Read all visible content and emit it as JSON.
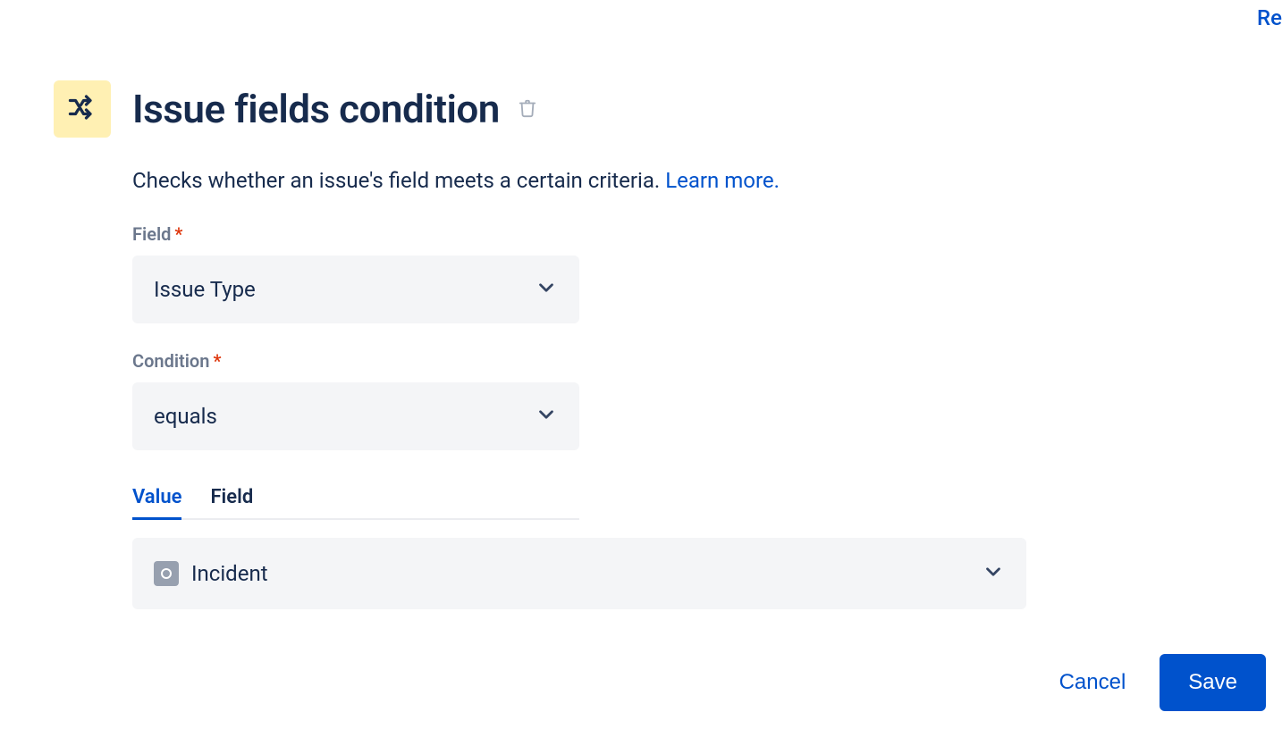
{
  "topLink": "Re",
  "header": {
    "title": "Issue fields condition"
  },
  "description": "Checks whether an issue's field meets a certain criteria. ",
  "learnMore": "Learn more.",
  "fields": {
    "fieldLabel": "Field",
    "fieldValue": "Issue Type",
    "conditionLabel": "Condition",
    "conditionValue": "equals"
  },
  "tabs": {
    "value": "Value",
    "field": "Field"
  },
  "valueSelect": "Incident",
  "buttons": {
    "cancel": "Cancel",
    "save": "Save"
  }
}
